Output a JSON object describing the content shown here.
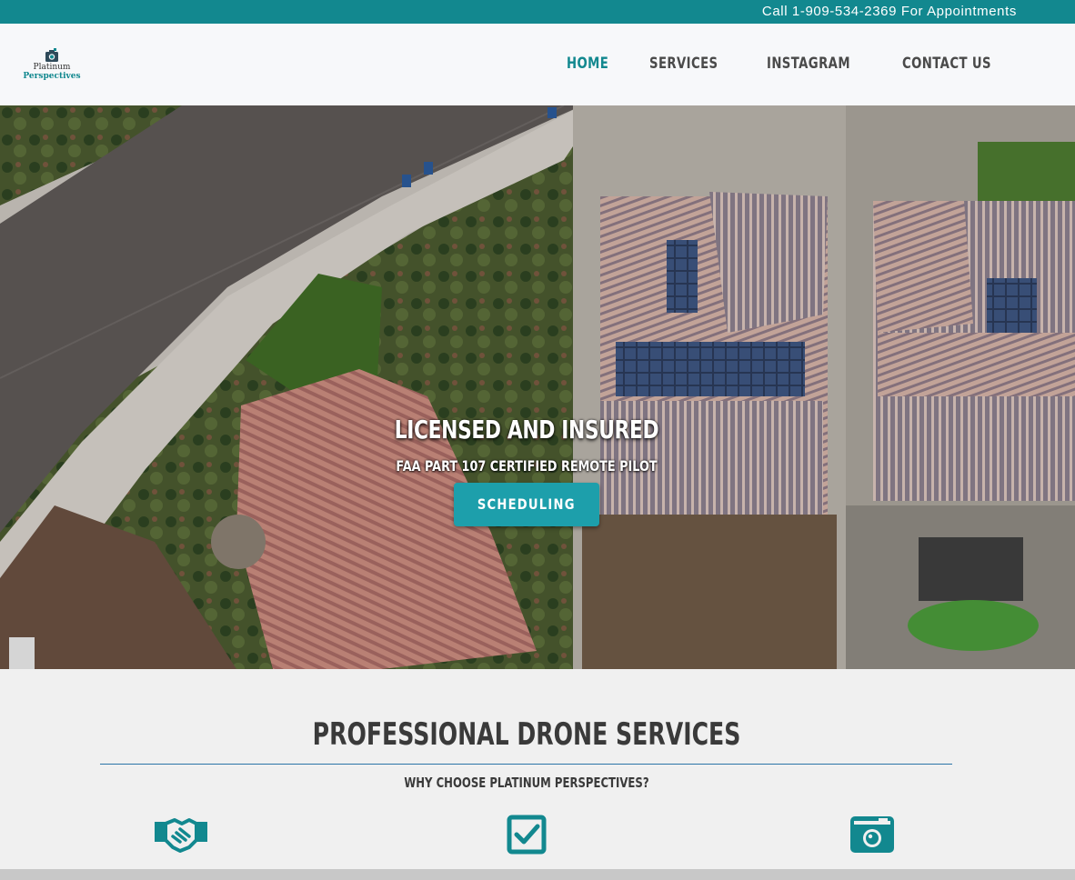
{
  "topbar": {
    "text": "Call 1-909-534-2369 For Appointments"
  },
  "logo": {
    "line1": "Platinum",
    "line2": "Perspectives"
  },
  "nav": {
    "items": [
      {
        "label": "HOME",
        "active": true
      },
      {
        "label": "SERVICES",
        "active": false
      },
      {
        "label": "INSTAGRAM",
        "active": false
      },
      {
        "label": "CONTACT US",
        "active": false
      }
    ]
  },
  "hero": {
    "title": "LICENSED AND INSURED",
    "subtitle": "FAA PART 107 CERTIFIED REMOTE PILOT",
    "button_label": "SCHEDULING"
  },
  "services": {
    "title": "PROFESSIONAL DRONE SERVICES",
    "subtitle": "WHY CHOOSE PLATINUM PERSPECTIVES?",
    "features": [
      {
        "icon": "handshake-icon"
      },
      {
        "icon": "checkbox-icon"
      },
      {
        "icon": "camera-icon"
      }
    ]
  },
  "colors": {
    "accent": "#12888f",
    "button": "#1d9fab",
    "text_dark": "#3a3a3a"
  }
}
